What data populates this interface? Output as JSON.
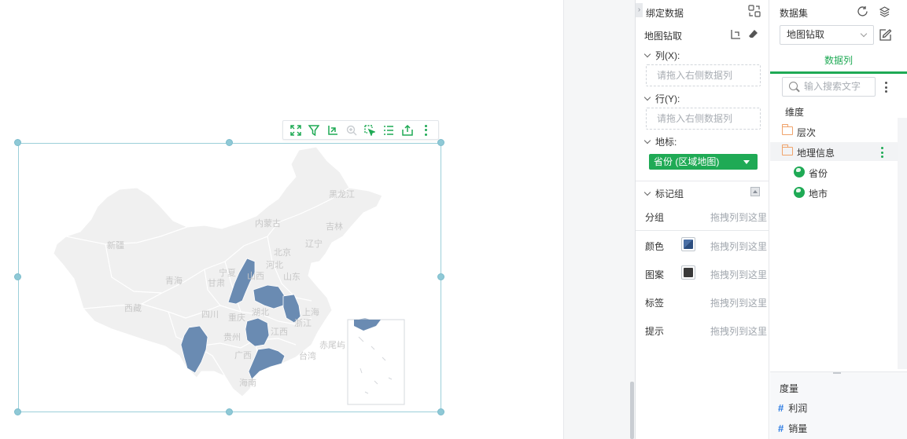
{
  "bind_panel": {
    "title": "绑定数据",
    "map_drill": "地图钻取",
    "columns_label": "列(X):",
    "columns_placeholder": "请拖入右侧数据列",
    "rows_label": "行(Y):",
    "rows_placeholder": "请拖入右侧数据列",
    "geo_label": "地标:",
    "geo_field": "省份 (区域地图)",
    "mark_group_label": "标记组",
    "marks": [
      {
        "label": "分组",
        "hint": "拖拽列到这里"
      },
      {
        "label": "颜色",
        "hint": "拖拽列到这里",
        "swatch": "#4a6fa5"
      },
      {
        "label": "图案",
        "hint": "拖拽列到这里",
        "swatch": "#3a3a3a"
      },
      {
        "label": "标签",
        "hint": "拖拽列到这里"
      },
      {
        "label": "提示",
        "hint": "拖拽列到这里"
      }
    ]
  },
  "dataset_panel": {
    "title": "数据集",
    "selected_dataset": "地图钻取",
    "tab": "数据列",
    "search_placeholder": "输入搜索文字",
    "dimension_header": "维度",
    "tree": [
      {
        "label": "层次",
        "icon": "folder-icon"
      },
      {
        "label": "地理信息",
        "icon": "folder-icon"
      },
      {
        "label": "省份",
        "icon": "globe-icon"
      },
      {
        "label": "地市",
        "icon": "globe-icon"
      }
    ],
    "measure_header": "度量",
    "measures": [
      "利润",
      "销量"
    ]
  },
  "map": {
    "highlight_color": "#6a8bb2",
    "base_color": "#f0f0f0",
    "province_labels": [
      "黑龙江",
      "吉林",
      "内蒙古",
      "辽宁",
      "北京",
      "河北",
      "新疆",
      "宁夏",
      "山东",
      "甘肃",
      "青海",
      "山西",
      "西藏",
      "四川",
      "湖北",
      "上海",
      "浙江",
      "重庆",
      "贵州",
      "江西",
      "赤尾屿",
      "台湾",
      "广西",
      "海南"
    ]
  },
  "chart_toolbar": [
    "expand-icon",
    "filter-icon",
    "drill-icon",
    "zoom-icon",
    "select-icon",
    "list-icon",
    "export-icon",
    "more-icon"
  ],
  "colors": {
    "accent": "#1faa55",
    "frame": "#9ccfd9"
  }
}
